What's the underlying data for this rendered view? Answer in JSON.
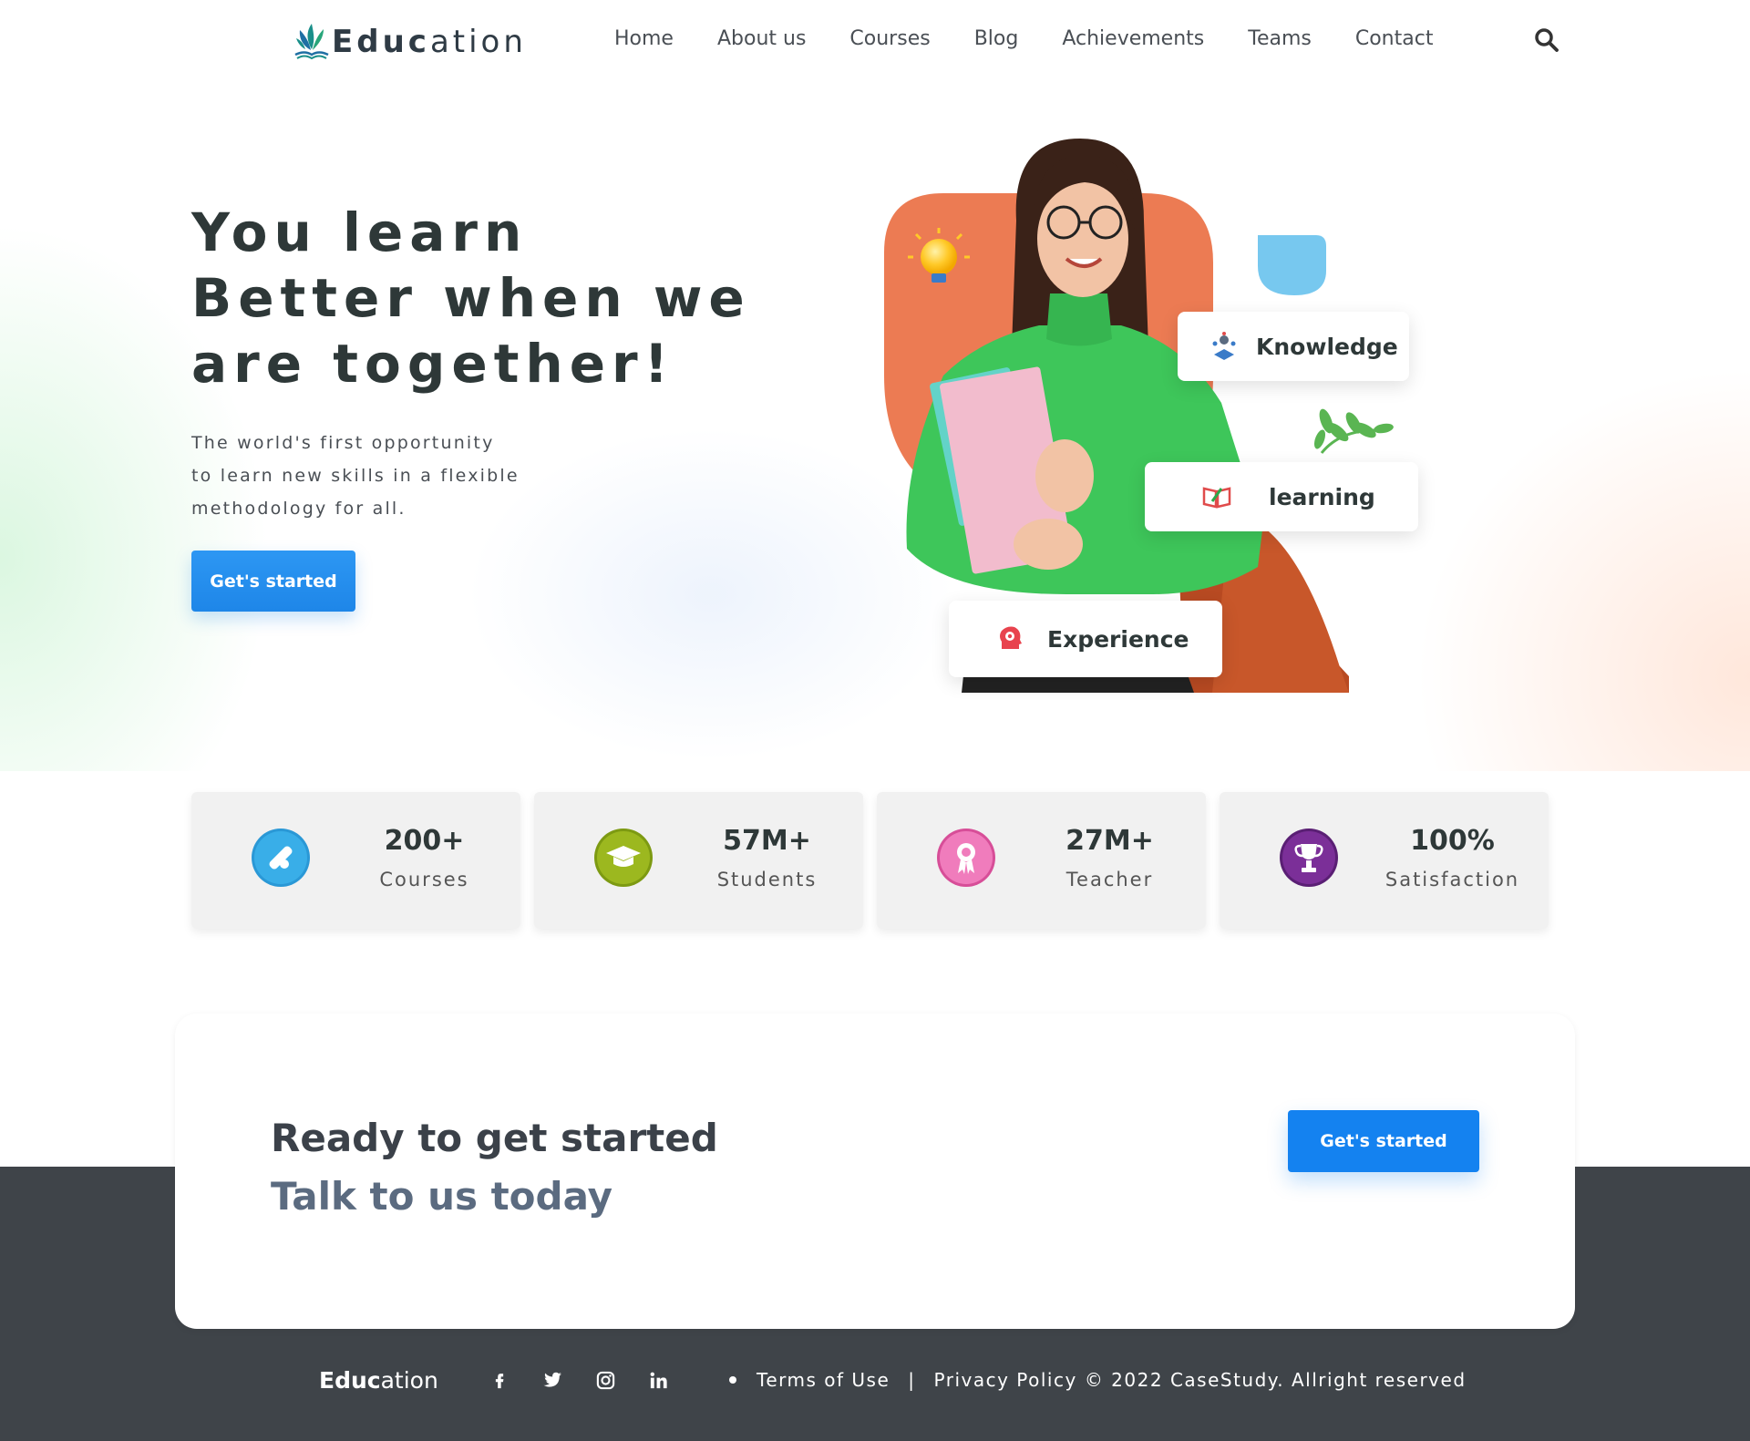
{
  "brand": {
    "name_bold": "Educ",
    "name_rest": "ation"
  },
  "nav": {
    "items": [
      {
        "label": "Home"
      },
      {
        "label": "About us"
      },
      {
        "label": "Courses"
      },
      {
        "label": "Blog"
      },
      {
        "label": "Achievements"
      },
      {
        "label": "Teams"
      },
      {
        "label": "Contact"
      }
    ],
    "search_icon": "search-icon"
  },
  "hero": {
    "title_line1": "You learn",
    "title_line2": "Better when we",
    "title_line3": "are together!",
    "subtitle_line1": "The world's first opportunity",
    "subtitle_line2": "to learn new skills in a flexible",
    "subtitle_line3": "methodology for all.",
    "cta_label": "Get's started",
    "tags": {
      "knowledge": "Knowledge",
      "learning": "learning",
      "experience": "Experience"
    },
    "colors": {
      "orange_blob": "#ec7b53",
      "blue_blob": "#77c8ef",
      "sweater": "#3ec65a",
      "accent_blue": "#1e86e8"
    }
  },
  "stats": [
    {
      "value": "200+",
      "label": "Courses",
      "icon": "diploma-icon",
      "color": "#2a98d6"
    },
    {
      "value": "57M+",
      "label": "Students",
      "icon": "graduation-cap-icon",
      "color": "#8aa619"
    },
    {
      "value": "27M+",
      "label": "Teacher",
      "icon": "award-ribbon-icon",
      "color": "#e55aa6"
    },
    {
      "value": "100%",
      "label": "Satisfaction",
      "icon": "trophy-icon",
      "color": "#6e2a8a"
    }
  ],
  "cta": {
    "title": "Ready to get started",
    "subtitle": "Talk to us today",
    "button_label": "Get's started"
  },
  "footer": {
    "logo_bold": "Educ",
    "logo_rest": "ation",
    "socials": [
      "facebook-icon",
      "twitter-icon",
      "instagram-icon",
      "linkedin-icon"
    ],
    "terms_label": "Terms of Use",
    "separator": "|",
    "privacy_label": "Privacy Policy",
    "copyright": "© 2022 CaseStudy.  Allright reserved",
    "bg_color": "#3f4449"
  }
}
